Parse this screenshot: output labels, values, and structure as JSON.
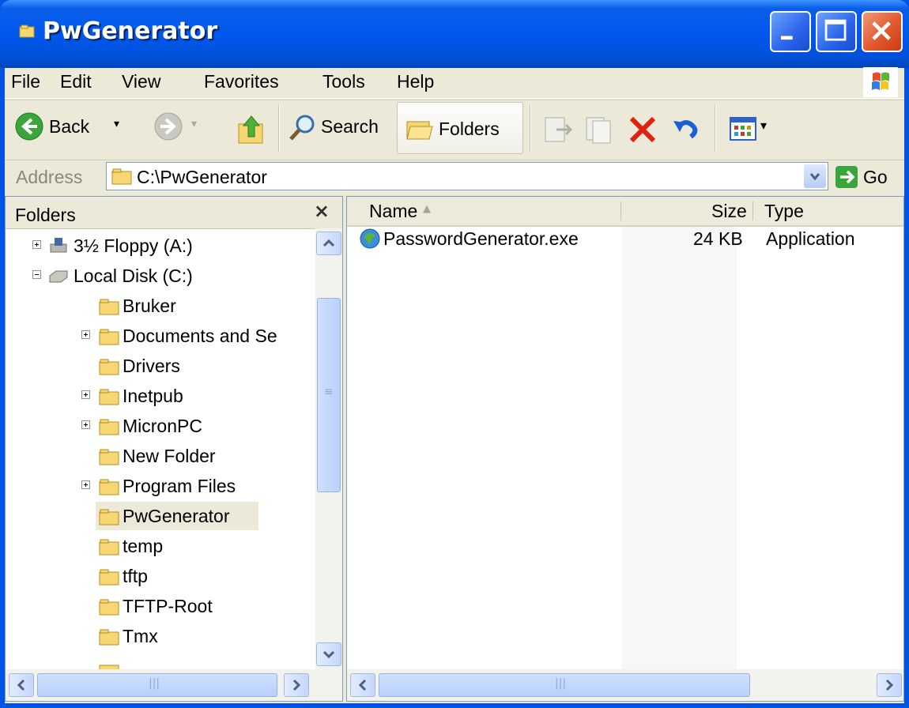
{
  "window": {
    "title": "PwGenerator"
  },
  "menu": {
    "items": [
      "File",
      "Edit",
      "View",
      "Favorites",
      "Tools",
      "Help"
    ]
  },
  "toolbar": {
    "back_label": "Back",
    "search_label": "Search",
    "folders_label": "Folders"
  },
  "address": {
    "label": "Address",
    "value": "C:\\PwGenerator",
    "go_label": "Go"
  },
  "folders_pane": {
    "title": "Folders",
    "close_glyph": "×",
    "tree": [
      {
        "label": "3½ Floppy (A:)",
        "expander": "plus",
        "icon": "floppy-drive-icon",
        "level": 1
      },
      {
        "label": "Local Disk (C:)",
        "expander": "minus",
        "icon": "hard-disk-icon",
        "level": 1
      },
      {
        "label": "Bruker",
        "expander": "",
        "icon": "folder-icon",
        "level": 2
      },
      {
        "label": "Documents and Se",
        "expander": "plus",
        "icon": "folder-icon",
        "level": 2
      },
      {
        "label": "Drivers",
        "expander": "",
        "icon": "folder-icon",
        "level": 2
      },
      {
        "label": "Inetpub",
        "expander": "plus",
        "icon": "folder-icon",
        "level": 2
      },
      {
        "label": "MicronPC",
        "expander": "plus",
        "icon": "folder-icon",
        "level": 2
      },
      {
        "label": "New Folder",
        "expander": "",
        "icon": "folder-icon",
        "level": 2
      },
      {
        "label": "Program Files",
        "expander": "plus",
        "icon": "folder-icon",
        "level": 2
      },
      {
        "label": "PwGenerator",
        "expander": "",
        "icon": "folder-icon",
        "level": 2,
        "selected": true
      },
      {
        "label": "temp",
        "expander": "",
        "icon": "folder-icon",
        "level": 2
      },
      {
        "label": "tftp",
        "expander": "",
        "icon": "folder-icon",
        "level": 2
      },
      {
        "label": "TFTP-Root",
        "expander": "",
        "icon": "folder-icon",
        "level": 2
      },
      {
        "label": "Tmx",
        "expander": "",
        "icon": "folder-icon",
        "level": 2
      }
    ]
  },
  "file_list": {
    "columns": [
      "Name",
      "Size",
      "Type"
    ],
    "sorted_column": "Name",
    "rows": [
      {
        "name": "PasswordGenerator.exe",
        "size": "24 KB",
        "type": "Application",
        "icon": "application-exe-icon"
      }
    ]
  },
  "colors": {
    "titlebar_blue": "#0058ee",
    "close_button_red": "#e2582f",
    "chrome_beige": "#ece9d8",
    "selected_bg": "#ece9d8"
  }
}
